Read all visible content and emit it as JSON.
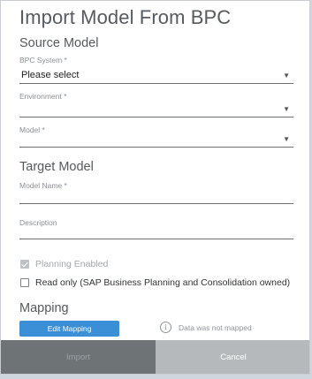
{
  "dialog": {
    "title": "Import Model From BPC"
  },
  "source": {
    "section_title": "Source Model",
    "bpc_system": {
      "label": "BPC System *",
      "value": "Please select"
    },
    "environment": {
      "label": "Environment *",
      "value": ""
    },
    "model": {
      "label": "Model *",
      "value": ""
    }
  },
  "target": {
    "section_title": "Target Model",
    "model_name": {
      "label": "Model Name *",
      "value": ""
    },
    "description": {
      "label": "Description",
      "value": ""
    }
  },
  "options": {
    "planning_enabled": {
      "label": "Planning Enabled",
      "checked": true,
      "disabled": true
    },
    "read_only": {
      "label": "Read only (SAP Business Planning and Consolidation owned)",
      "checked": false
    }
  },
  "mapping": {
    "section_title": "Mapping",
    "edit_label": "Edit Mapping",
    "info_text": "Data was not mapped",
    "info_icon": "info-icon"
  },
  "footer": {
    "import_label": "Import",
    "cancel_label": "Cancel"
  },
  "colors": {
    "primary": "#3a8fd6",
    "import_bg": "#6e7376",
    "cancel_bg": "#b6b9bb"
  }
}
